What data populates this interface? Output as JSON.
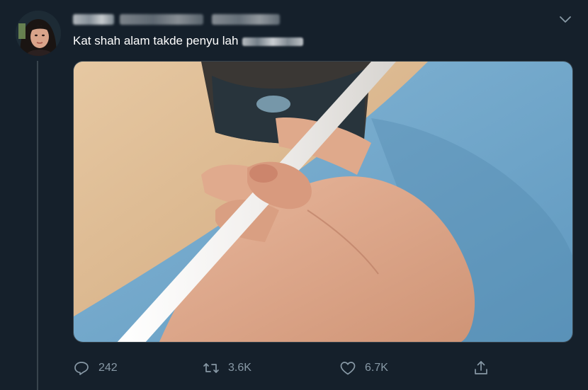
{
  "tweet": {
    "author_display_name": "",
    "text": "Kat shah alam takde penyu lah",
    "image_alt": "Hand holding a paper straw in front of a cup"
  },
  "actions": {
    "reply_count": "242",
    "retweet_count": "3.6K",
    "like_count": "6.7K"
  },
  "icons": {
    "reply": "reply-icon",
    "retweet": "retweet-icon",
    "like": "heart-icon",
    "share": "share-icon",
    "menu": "chevron-down-icon"
  },
  "colors": {
    "background": "#15202b",
    "muted": "#8899a6",
    "text": "#ffffff",
    "divider": "#38444d"
  }
}
